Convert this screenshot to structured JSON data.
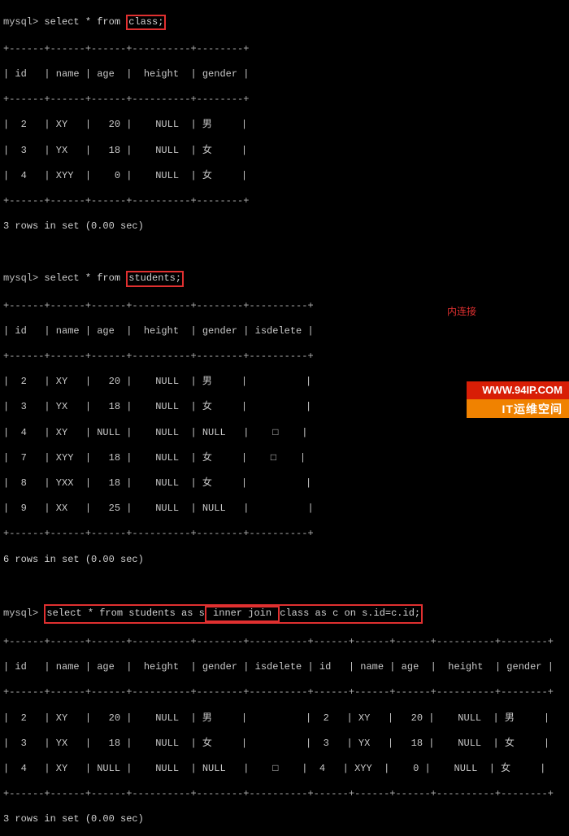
{
  "prompt": "mysql>",
  "query1": {
    "before": " select * from ",
    "highlight": "class;",
    "after": ""
  },
  "table1": {
    "sep": "+------+------+------+----------+--------+",
    "head": "| id   | name | age  |  height  | gender |",
    "rows": [
      "|  2   | XY   |   20 |    NULL  | 男     |",
      "|  3   | YX   |   18 |    NULL  | 女     |",
      "|  4   | XYY  |    0 |    NULL  | 女     |"
    ],
    "summary": "3 rows in set (0.00 sec)"
  },
  "query2": {
    "before": " select * from ",
    "highlight": "students;",
    "after": ""
  },
  "table2": {
    "sep": "+------+------+------+----------+--------+----------+",
    "head": "| id   | name | age  |  height  | gender | isdelete |",
    "rows": [
      "|  2   | XY   |   20 |    NULL  | 男     |          |",
      "|  3   | YX   |   18 |    NULL  | 女     |          |",
      "|  4   | XY   | NULL |    NULL  | NULL   |    □    |",
      "|  7   | XYY  |   18 |    NULL  | 女     |    □    |",
      "|  8   | YXX  |   18 |    NULL  | 女     |          |",
      "|  9   | XX   |   25 |    NULL  | NULL   |          |"
    ],
    "summary": "6 rows in set (0.00 sec)"
  },
  "query3": {
    "seg1": "select * from students as s",
    "seg2": " inner join ",
    "seg3": "class as c on s.id=c.id;"
  },
  "annotation3": "内连接",
  "table3": {
    "sep": "+------+------+------+----------+--------+----------+------+------+------+----------+--------+",
    "head": "| id   | name | age  |  height  | gender | isdelete | id   | name | age  |  height  | gender |",
    "rows": [
      "|  2   | XY   |   20 |    NULL  | 男     |          |  2   | XY   |   20 |    NULL  | 男     |",
      "|  3   | YX   |   18 |    NULL  | 女     |          |  3   | YX   |   18 |    NULL  | 女     |",
      "|  4   | XY   | NULL |    NULL  | NULL   |    □    |  4   | XYY  |    0 |    NULL  | 女     |"
    ],
    "summary": "3 rows in set (0.00 sec)"
  },
  "watermark": {
    "line1": "WWW.94IP.COM",
    "line2": "IT运维空间"
  },
  "chart_data": {
    "type": "table",
    "tables": [
      {
        "name": "class",
        "columns": [
          "id",
          "name",
          "age",
          "height",
          "gender"
        ],
        "rows": [
          [
            2,
            "XY",
            20,
            null,
            "男"
          ],
          [
            3,
            "YX",
            18,
            null,
            "女"
          ],
          [
            4,
            "XYY",
            0,
            null,
            "女"
          ]
        ],
        "row_count_text": "3 rows in set (0.00 sec)"
      },
      {
        "name": "students",
        "columns": [
          "id",
          "name",
          "age",
          "height",
          "gender",
          "isdelete"
        ],
        "rows": [
          [
            2,
            "XY",
            20,
            null,
            "男",
            null
          ],
          [
            3,
            "YX",
            18,
            null,
            "女",
            null
          ],
          [
            4,
            "XY",
            null,
            null,
            null,
            "□"
          ],
          [
            7,
            "XYY",
            18,
            null,
            "女",
            "□"
          ],
          [
            8,
            "YXX",
            18,
            null,
            "女",
            null
          ],
          [
            9,
            "XX",
            25,
            null,
            null,
            null
          ]
        ],
        "row_count_text": "6 rows in set (0.00 sec)"
      },
      {
        "name": "students_inner_join_class",
        "query": "select * from students as s inner join class as c on s.id=c.id;",
        "annotation": "内连接",
        "columns": [
          "id",
          "name",
          "age",
          "height",
          "gender",
          "isdelete",
          "id",
          "name",
          "age",
          "height",
          "gender"
        ],
        "rows": [
          [
            2,
            "XY",
            20,
            null,
            "男",
            null,
            2,
            "XY",
            20,
            null,
            "男"
          ],
          [
            3,
            "YX",
            18,
            null,
            "女",
            null,
            3,
            "YX",
            18,
            null,
            "女"
          ],
          [
            4,
            "XY",
            null,
            null,
            null,
            "□",
            4,
            "XYY",
            0,
            null,
            "女"
          ]
        ],
        "row_count_text": "3 rows in set (0.00 sec)"
      }
    ]
  }
}
